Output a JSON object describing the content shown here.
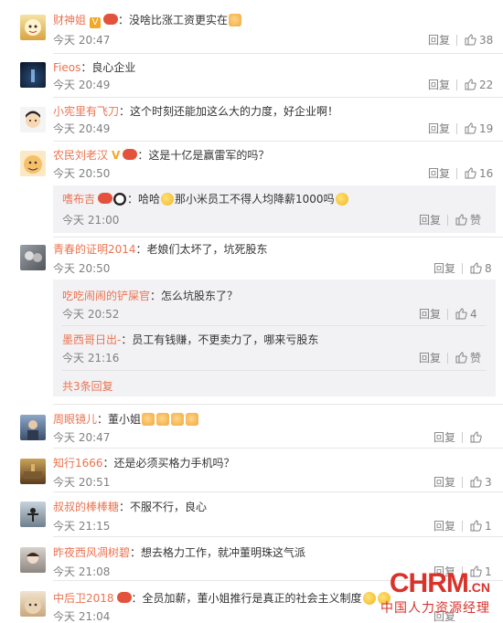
{
  "ui": {
    "reply": "回复",
    "like": "赞"
  },
  "comments": [
    {
      "user": "财神姐",
      "text": "：没啥比涨工资更实在",
      "time": "今天 20:47",
      "likes": "38"
    },
    {
      "user": "Fieos",
      "text": "：良心企业",
      "time": "今天 20:49",
      "likes": "22"
    },
    {
      "user": "小宪里有飞刀",
      "text": "：这个时刻还能加这么大的力度，好企业啊！",
      "time": "今天 20:49",
      "likes": "19"
    },
    {
      "user": "农民刘老汉",
      "text": "：这是十亿是赢雷军的吗？",
      "time": "今天 20:50",
      "likes": "16",
      "replies": [
        {
          "user": "嗜布吉",
          "text_a": "：哈哈",
          "text_b": "那小米员工不得人均降薪1000吗",
          "time": "今天 21:00",
          "likes": ""
        }
      ]
    },
    {
      "user": "青春的证明2014",
      "text": "：老娘们太坏了，坑死股东",
      "time": "今天 20:50",
      "likes": "8",
      "replies": [
        {
          "user": "吃吃闹闹的铲屎官",
          "text": "：怎么坑股东了？",
          "time": "今天 20:52",
          "likes": "4"
        },
        {
          "user": "墨西哥日出-",
          "text": "：员工有钱赚，不更卖力了，哪来亏股东",
          "time": "今天 21:16",
          "likes": ""
        }
      ],
      "more": "共3条回复"
    },
    {
      "user": "周眼镜儿",
      "text": "：董小姐",
      "time": "今天 20:47",
      "likes": ""
    },
    {
      "user": "知行1666",
      "text": "：还是必须买格力手机吗？",
      "time": "今天 20:51",
      "likes": "3"
    },
    {
      "user": "叔叔的棒棒糖",
      "text": "：不服不行，良心",
      "time": "今天 21:15",
      "likes": "1"
    },
    {
      "user": "昨夜西风凋树碧",
      "text": "：想去格力工作，就冲董明珠这气派",
      "time": "今天 21:08",
      "likes": "1"
    },
    {
      "user": "中后卫2018",
      "text": "：全员加薪，董小姐推行是真正的社会主义制度",
      "time": "今天 21:04",
      "likes": ""
    }
  ],
  "watermark": {
    "main": "CHRM",
    "suffix": ".CN",
    "sub": "中国人力资源经理"
  },
  "colors": {
    "username": "#eb7350",
    "meta": "#808080",
    "subbox": "#f2f2f5",
    "watermark": "#d9322b"
  }
}
